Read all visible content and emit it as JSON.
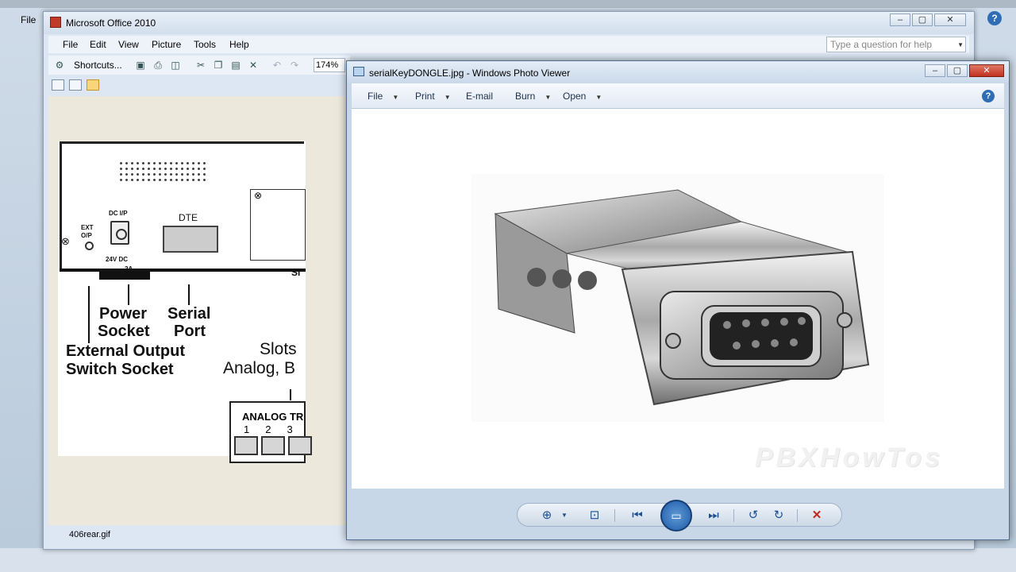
{
  "background": {
    "menu_file": "File",
    "help_glyph": "?",
    "status_text": ""
  },
  "office": {
    "title": "Microsoft Office 2010",
    "menu": [
      "File",
      "Edit",
      "View",
      "Picture",
      "Tools",
      "Help"
    ],
    "help_placeholder": "Type a question for help",
    "shortcuts_label": "Shortcuts...",
    "zoom": "174%",
    "status_filename": "406rear.gif"
  },
  "diagram": {
    "ext_label_1": "EXT",
    "ext_label_2": "O/P",
    "dc_label": "DC I/P",
    "dc_volt_1": "24V DC",
    "dc_volt_2": "2A",
    "dte_label": "DTE",
    "slot_partial": "Sl",
    "power_1": "Power",
    "power_2": "Socket",
    "serial_1": "Serial",
    "serial_2": "Port",
    "ext_out_1": "External Output",
    "ext_out_2": "Switch Socket",
    "slots_1": "Slots",
    "slots_2": "Analog, B",
    "analog_label": "ANALOG TR",
    "analog_nums": "123"
  },
  "viewer": {
    "title": "serialKeyDONGLE.jpg - Windows Photo Viewer",
    "commands": [
      "File",
      "Print",
      "E-mail",
      "Burn",
      "Open"
    ],
    "watermark": "PBXHowTos",
    "help_glyph": "?"
  },
  "colors": {
    "accent": "#2f6db5",
    "close": "#c1321f"
  }
}
